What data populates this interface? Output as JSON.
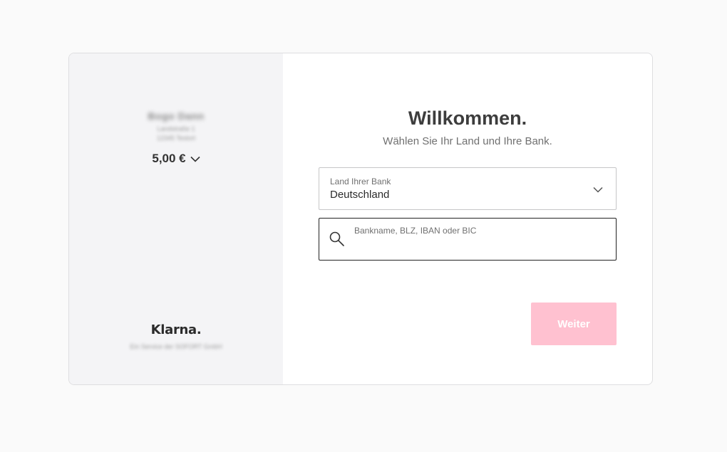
{
  "merchant": {
    "name": "Bogo Dann",
    "address_line1": "Landstraße 1",
    "address_line2": "12345 Testort",
    "amount": "5,00 €",
    "chevron_icon": "chevron-down-icon"
  },
  "brand": {
    "logo": "Klarna.",
    "note": "Ein Service der SOFORT GmbH"
  },
  "main": {
    "title": "Willkommen.",
    "subtitle": "Wählen Sie Ihr Land und Ihre Bank.",
    "country_label": "Land Ihrer Bank",
    "country_value": "Deutschland",
    "search_placeholder": "Bankname, BLZ, IBAN oder BIC",
    "search_icon": "search-icon",
    "continue_label": "Weiter"
  },
  "colors": {
    "button_bg": "#ffc1d0",
    "left_panel_bg": "#f4f4f6",
    "title": "#3d3d3d"
  }
}
